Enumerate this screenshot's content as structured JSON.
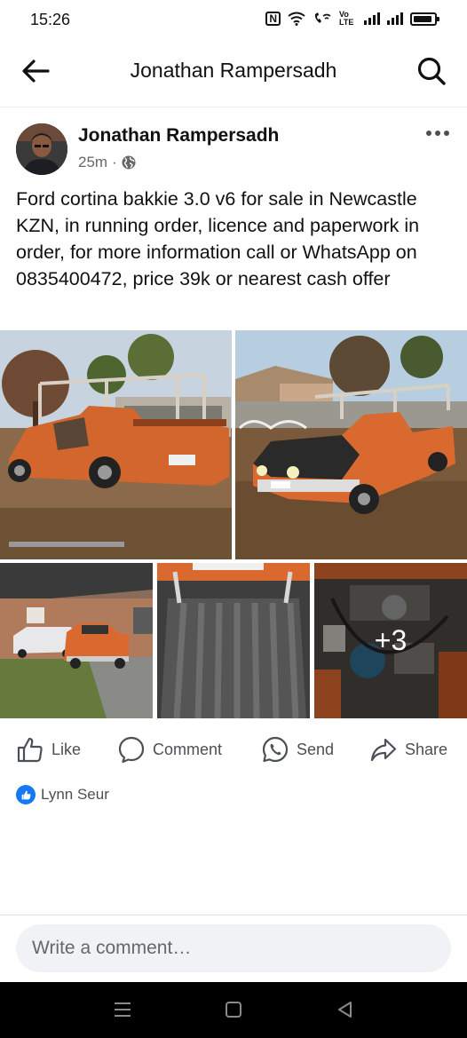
{
  "status_bar": {
    "time": "15:26",
    "icons": [
      "nfc-icon",
      "wifi-icon",
      "wifi-calling-icon",
      "volte-icon",
      "signal-icon",
      "signal-icon",
      "battery-icon"
    ],
    "nfc_glyph": "N",
    "volte_text": "Vo LTE"
  },
  "header": {
    "title": "Jonathan Rampersadh",
    "back_icon": "back-arrow-icon",
    "search_icon": "search-icon"
  },
  "post": {
    "author": "Jonathan Rampersadh",
    "time_ago": "25m",
    "separator": "·",
    "privacy_icon": "globe-icon",
    "text": "Ford cortina bakkie 3.0 v6 for sale in Newcastle KZN, in running order, licence and paperwork in order, for more information call or WhatsApp  on 0835400472, price 39k or nearest cash offer",
    "more_photos_label": "+3"
  },
  "actions": [
    {
      "label": "Like",
      "icon": "like-icon"
    },
    {
      "label": "Comment",
      "icon": "comment-icon"
    },
    {
      "label": "Send",
      "icon": "whatsapp-send-icon"
    },
    {
      "label": "Share",
      "icon": "share-icon"
    }
  ],
  "reactions": {
    "icon": "like-reaction-icon",
    "names": "Lynn Seur"
  },
  "comment_input": {
    "placeholder": "Write a comment…"
  },
  "colors": {
    "accent": "#1877f2",
    "secondary_text": "#65676b",
    "input_bg": "#f0f2f5",
    "bakkie_orange": "#d9692e"
  }
}
